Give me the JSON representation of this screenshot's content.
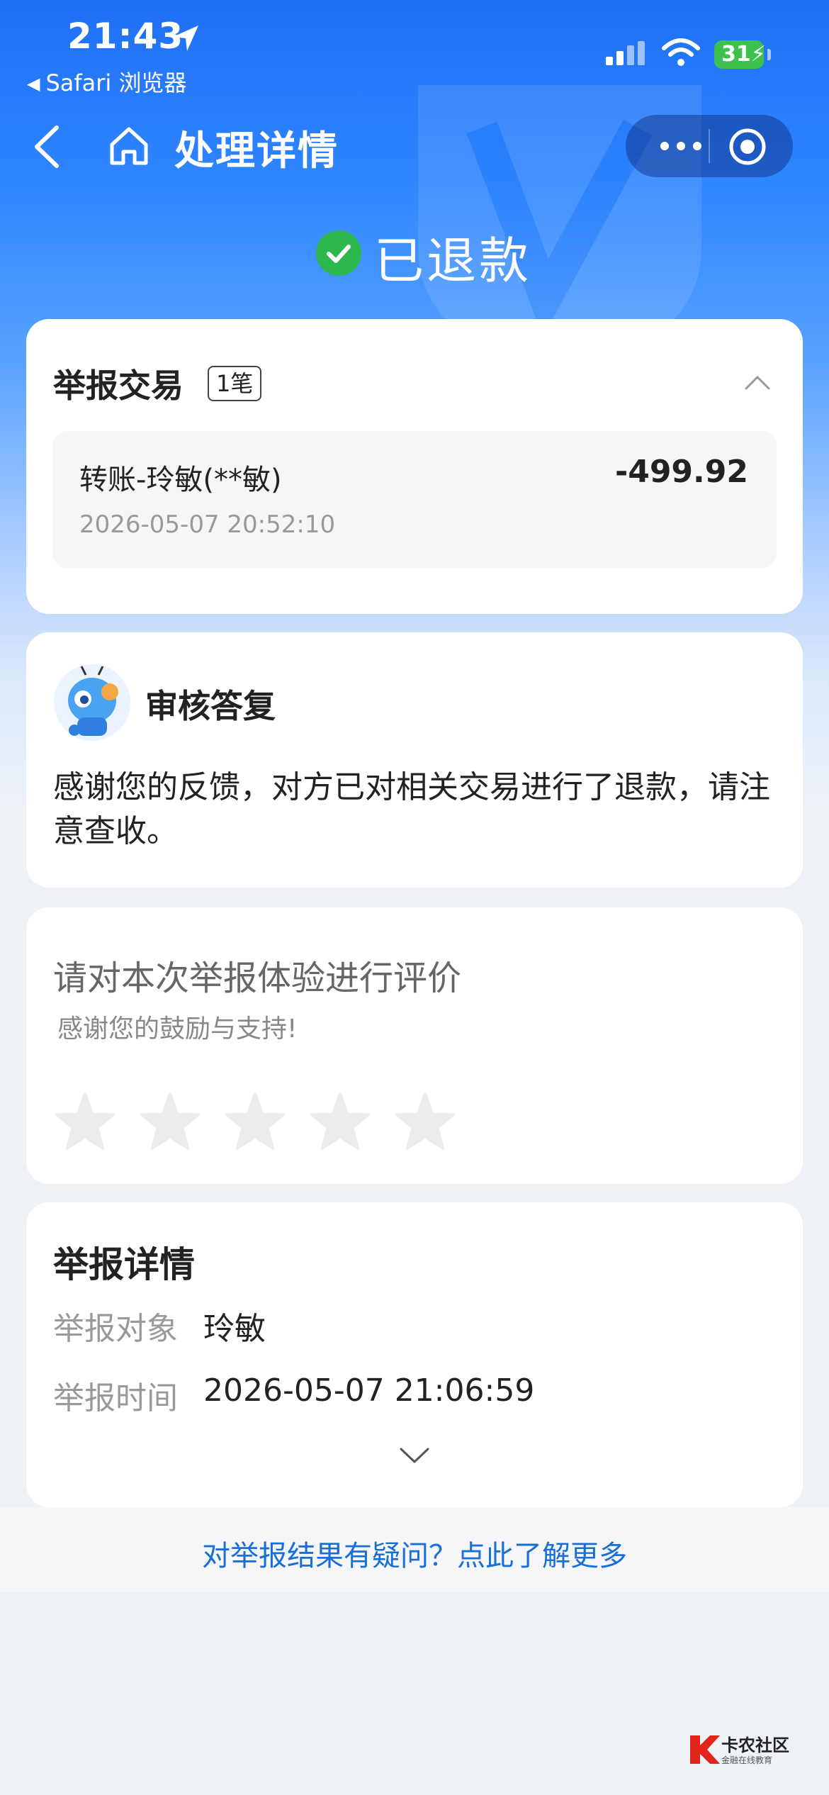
{
  "status_bar": {
    "time": "21:43",
    "back_app": "Safari 浏览器",
    "battery": "31"
  },
  "nav": {
    "title": "处理详情"
  },
  "status": {
    "text": "已退款",
    "color": "#2db84d"
  },
  "report_transaction": {
    "title": "举报交易",
    "count_badge": "1笔",
    "item": {
      "name": "转账-玲敏(**敏)",
      "amount": "-499.92",
      "time": "2026-05-07 20:52:10"
    }
  },
  "review_reply": {
    "title": "审核答复",
    "body": "感谢您的反馈，对方已对相关交易进行了退款，请注意查收。"
  },
  "rating": {
    "title": "请对本次举报体验进行评价",
    "subtitle": "感谢您的鼓励与支持!",
    "max_stars": 5,
    "selected": 0
  },
  "report_details": {
    "title": "举报详情",
    "rows": [
      {
        "label": "举报对象",
        "value": "玲敏"
      },
      {
        "label": "举报时间",
        "value": "2026-05-07 21:06:59"
      }
    ]
  },
  "footer": {
    "link": "对举报结果有疑问？点此了解更多"
  },
  "logo": {
    "name": "卡农社区",
    "tagline": "金融在线教育"
  },
  "colors": {
    "accent_blue": "#1a6fd6",
    "brand_gradient_top": "#1f6ff5"
  }
}
